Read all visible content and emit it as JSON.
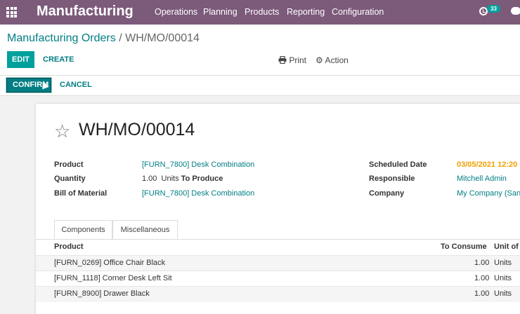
{
  "navbar": {
    "brand": "Manufacturing",
    "menu": [
      "Operations",
      "Planning",
      "Products",
      "Reporting",
      "Configuration"
    ],
    "activity_count": "33",
    "brand_color": "#7c5a7a"
  },
  "control": {
    "breadcrumb_parent": "Manufacturing Orders",
    "breadcrumb_sep": "/",
    "breadcrumb_current": "WH/MO/00014",
    "edit_label": "EDIT",
    "create_label": "CREATE",
    "print_label": "Print",
    "action_label": "Action"
  },
  "status": {
    "confirm_label": "CONFIRM",
    "cancel_label": "CANCEL"
  },
  "form": {
    "title": "WH/MO/00014",
    "product_label": "Product",
    "product_value": "[FURN_7800] Desk Combination",
    "quantity_label": "Quantity",
    "quantity_value": "1.00",
    "quantity_unit": "Units",
    "quantity_suffix": "To Produce",
    "bom_label": "Bill of Material",
    "bom_value": "[FURN_7800] Desk Combination",
    "scheduled_label": "Scheduled Date",
    "scheduled_value": "03/05/2021 12:20",
    "responsible_label": "Responsible",
    "responsible_value": "Mitchell Admin",
    "company_label": "Company",
    "company_value": "My Company (San"
  },
  "tabs": [
    "Components",
    "Miscellaneous"
  ],
  "table": {
    "headers": {
      "product": "Product",
      "to_consume": "To Consume",
      "unit": "Unit of M"
    },
    "rows": [
      {
        "product": "[FURN_0269] Office Chair Black",
        "qty": "1.00",
        "unit": "Units"
      },
      {
        "product": "[FURN_1118] Corner Desk Left Sit",
        "qty": "1.00",
        "unit": "Units"
      },
      {
        "product": "[FURN_8900] Drawer Black",
        "qty": "1.00",
        "unit": "Units"
      }
    ]
  },
  "accent_color": "#00a09d",
  "icons": [
    "apps-grid-icon",
    "print-icon",
    "gear-icon",
    "star-icon",
    "clock-icon",
    "chat-icon",
    "cursor-icon"
  ]
}
